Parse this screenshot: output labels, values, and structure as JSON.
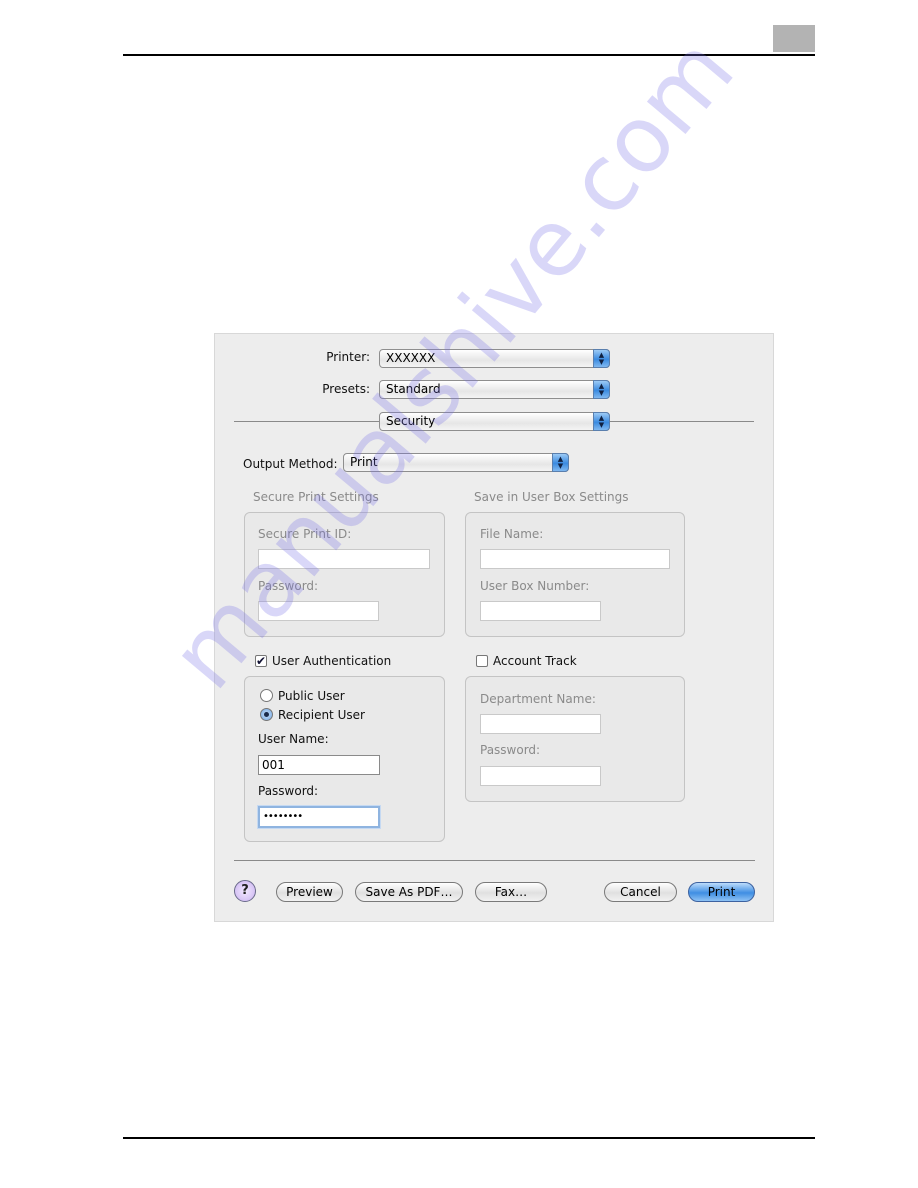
{
  "page": {
    "header_tab_color": "#b3b3b3",
    "watermark": "manualshive.com"
  },
  "dialog": {
    "printer": {
      "label": "Printer:",
      "value": "XXXXXX"
    },
    "presets": {
      "label": "Presets:",
      "value": "Standard"
    },
    "panel": {
      "value": "Security"
    },
    "output_method": {
      "label": "Output Method:",
      "value": "Print"
    },
    "secure_print": {
      "title": "Secure Print Settings",
      "id_label": "Secure Print ID:",
      "id_value": "",
      "password_label": "Password:",
      "password_value": ""
    },
    "user_box": {
      "title": "Save in User Box Settings",
      "file_label": "File Name:",
      "file_value": "",
      "number_label": "User Box Number:",
      "number_value": ""
    },
    "user_auth": {
      "label": "User Authentication",
      "checked": true,
      "public_user": "Public User",
      "recipient_user": "Recipient User",
      "selected": "Recipient User",
      "user_name_label": "User Name:",
      "user_name_value": "001",
      "password_label": "Password:",
      "password_value": "••••••••"
    },
    "account_track": {
      "label": "Account Track",
      "checked": false,
      "department_label": "Department Name:",
      "department_value": "",
      "password_label": "Password:",
      "password_value": ""
    },
    "buttons": {
      "help": "?",
      "preview": "Preview",
      "save_pdf": "Save As PDF…",
      "fax": "Fax…",
      "cancel": "Cancel",
      "print": "Print"
    },
    "accent_color": "#3f8ee3"
  }
}
